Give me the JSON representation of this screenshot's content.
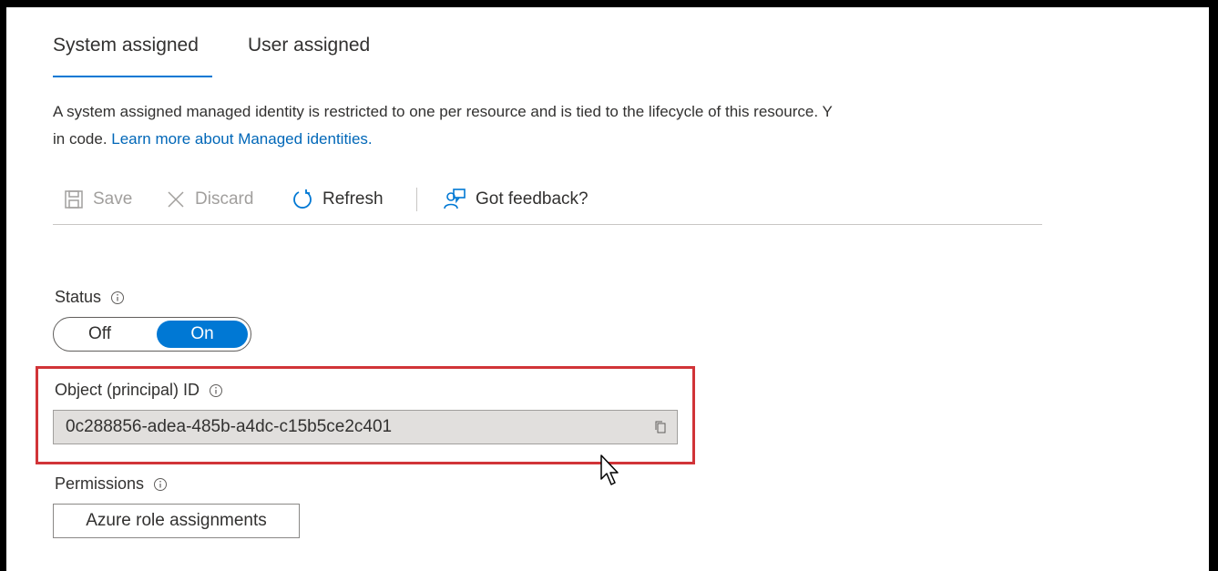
{
  "tabs": [
    {
      "label": "System assigned",
      "selected": true
    },
    {
      "label": "User assigned",
      "selected": false
    }
  ],
  "description": {
    "line1": "A system assigned managed identity is restricted to one per resource and is tied to the lifecycle of this resource. Y",
    "line2_prefix": "in code. ",
    "link_text": "Learn more about Managed identities."
  },
  "toolbar": {
    "save_label": "Save",
    "discard_label": "Discard",
    "refresh_label": "Refresh",
    "feedback_label": "Got feedback?"
  },
  "status": {
    "label": "Status",
    "off_label": "Off",
    "on_label": "On",
    "value": "On"
  },
  "object_id": {
    "label": "Object (principal) ID",
    "value": "0c288856-adea-485b-a4dc-c15b5ce2c401"
  },
  "permissions": {
    "label": "Permissions",
    "button_label": "Azure role assignments"
  },
  "colors": {
    "accent": "#0078d4",
    "link": "#0067b8",
    "highlight_border": "#d13438"
  },
  "icons": {
    "save": "save-icon",
    "discard": "discard-icon",
    "refresh": "refresh-icon",
    "feedback": "feedback-icon",
    "info": "info-icon",
    "copy": "copy-icon",
    "cursor": "mouse-pointer-icon"
  }
}
